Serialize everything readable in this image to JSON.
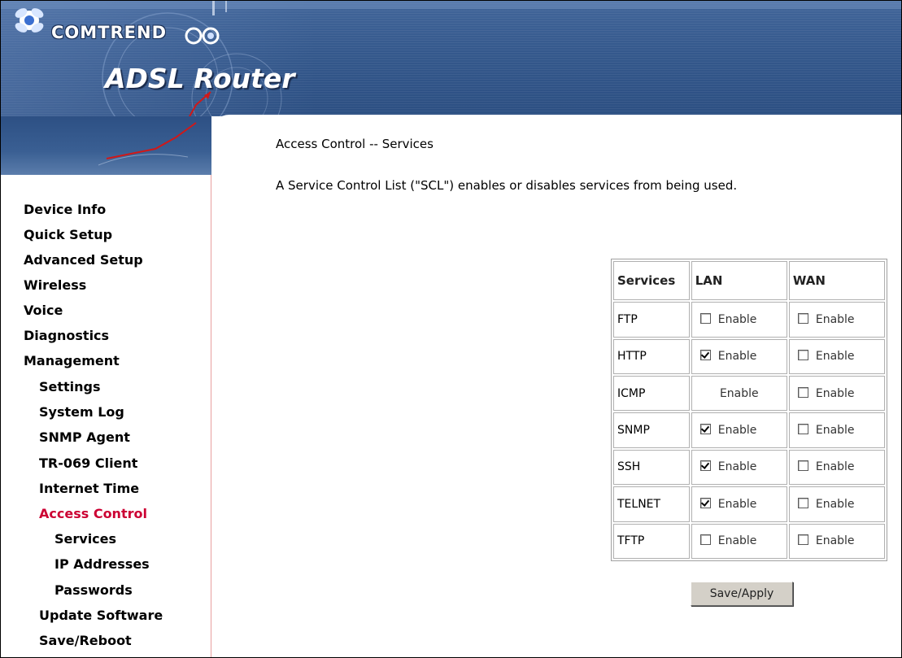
{
  "header": {
    "brand": "COMTREND",
    "product": "ADSL Router"
  },
  "sidebar": {
    "items": [
      {
        "label": "Device Info",
        "level": 0,
        "active": false
      },
      {
        "label": "Quick Setup",
        "level": 0,
        "active": false
      },
      {
        "label": "Advanced Setup",
        "level": 0,
        "active": false
      },
      {
        "label": "Wireless",
        "level": 0,
        "active": false
      },
      {
        "label": "Voice",
        "level": 0,
        "active": false
      },
      {
        "label": "Diagnostics",
        "level": 0,
        "active": false
      },
      {
        "label": "Management",
        "level": 0,
        "active": false
      },
      {
        "label": "Settings",
        "level": 1,
        "active": false
      },
      {
        "label": "System Log",
        "level": 1,
        "active": false
      },
      {
        "label": "SNMP Agent",
        "level": 1,
        "active": false
      },
      {
        "label": "TR-069 Client",
        "level": 1,
        "active": false
      },
      {
        "label": "Internet Time",
        "level": 1,
        "active": false
      },
      {
        "label": "Access Control",
        "level": 1,
        "active": true
      },
      {
        "label": "Services",
        "level": 2,
        "active": false
      },
      {
        "label": "IP Addresses",
        "level": 2,
        "active": false
      },
      {
        "label": "Passwords",
        "level": 2,
        "active": false
      },
      {
        "label": "Update Software",
        "level": 1,
        "active": false
      },
      {
        "label": "Save/Reboot",
        "level": 1,
        "active": false
      }
    ]
  },
  "main": {
    "title": "Access Control -- Services",
    "description": "A Service Control List (\"SCL\") enables or disables services from being used.",
    "table": {
      "headers": [
        "Services",
        "LAN",
        "WAN"
      ],
      "enable_label": "Enable",
      "rows": [
        {
          "service": "FTP",
          "lan": false,
          "wan": false,
          "lan_has_checkbox": true
        },
        {
          "service": "HTTP",
          "lan": true,
          "wan": false,
          "lan_has_checkbox": true
        },
        {
          "service": "ICMP",
          "lan": null,
          "wan": false,
          "lan_has_checkbox": false
        },
        {
          "service": "SNMP",
          "lan": true,
          "wan": false,
          "lan_has_checkbox": true
        },
        {
          "service": "SSH",
          "lan": true,
          "wan": false,
          "lan_has_checkbox": true
        },
        {
          "service": "TELNET",
          "lan": true,
          "wan": false,
          "lan_has_checkbox": true
        },
        {
          "service": "TFTP",
          "lan": false,
          "wan": false,
          "lan_has_checkbox": true
        }
      ]
    },
    "save_label": "Save/Apply"
  },
  "colors": {
    "banner": "#34588c",
    "active_menu": "#cc0033",
    "sidebar_border": "#e8a0a0",
    "button_face": "#d4d0c8"
  }
}
